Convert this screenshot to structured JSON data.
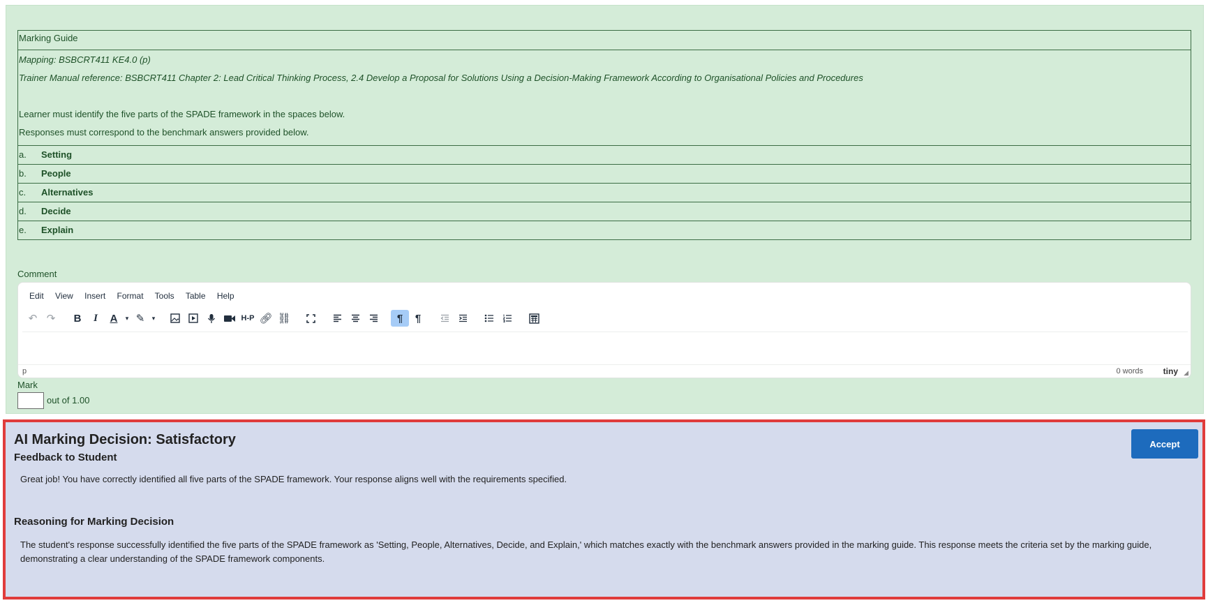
{
  "marking_guide": {
    "title": "Marking Guide",
    "mapping": "Mapping: BSBCRT411 KE4.0 (p)",
    "reference": "Trainer Manual reference: BSBCRT411 Chapter 2: Lead Critical Thinking Process, 2.4 Develop a Proposal for Solutions Using a Decision-Making Framework According to Organisational Policies and Procedures",
    "instruction_1": "Learner must identify the five parts of the SPADE framework in the spaces below.",
    "instruction_2": "Responses must correspond to the benchmark answers provided below.",
    "items": [
      {
        "letter": "a.",
        "answer": "Setting"
      },
      {
        "letter": "b.",
        "answer": "People"
      },
      {
        "letter": "c.",
        "answer": "Alternatives"
      },
      {
        "letter": "d.",
        "answer": "Decide"
      },
      {
        "letter": "e.",
        "answer": "Explain"
      }
    ]
  },
  "comment": {
    "label": "Comment",
    "menu": [
      "Edit",
      "View",
      "Insert",
      "Format",
      "Tools",
      "Table",
      "Help"
    ],
    "status_path": "p",
    "word_count": "0 words",
    "brand": "tiny"
  },
  "mark": {
    "label": "Mark",
    "value": "",
    "out_of": "out of 1.00"
  },
  "ai_decision": {
    "title": "AI Marking Decision: Satisfactory",
    "accept_label": "Accept",
    "feedback_heading": "Feedback to Student",
    "feedback_text": "Great job! You have correctly identified all five parts of the SPADE framework. Your response aligns well with the requirements specified.",
    "reasoning_heading": "Reasoning for Marking Decision",
    "reasoning_text": "The student's response successfully identified the five parts of the SPADE framework as 'Setting, People, Alternatives, Decide, and Explain,' which matches exactly with the benchmark answers provided in the marking guide. This response meets the criteria set by the marking guide, demonstrating a clear understanding of the SPADE framework components."
  },
  "colors": {
    "panel_bg": "#d4ecd8",
    "text_green": "#1e5128",
    "ai_bg": "#d5dbed",
    "ai_border": "#e03c3c",
    "accept_bg": "#1d6bbd"
  }
}
